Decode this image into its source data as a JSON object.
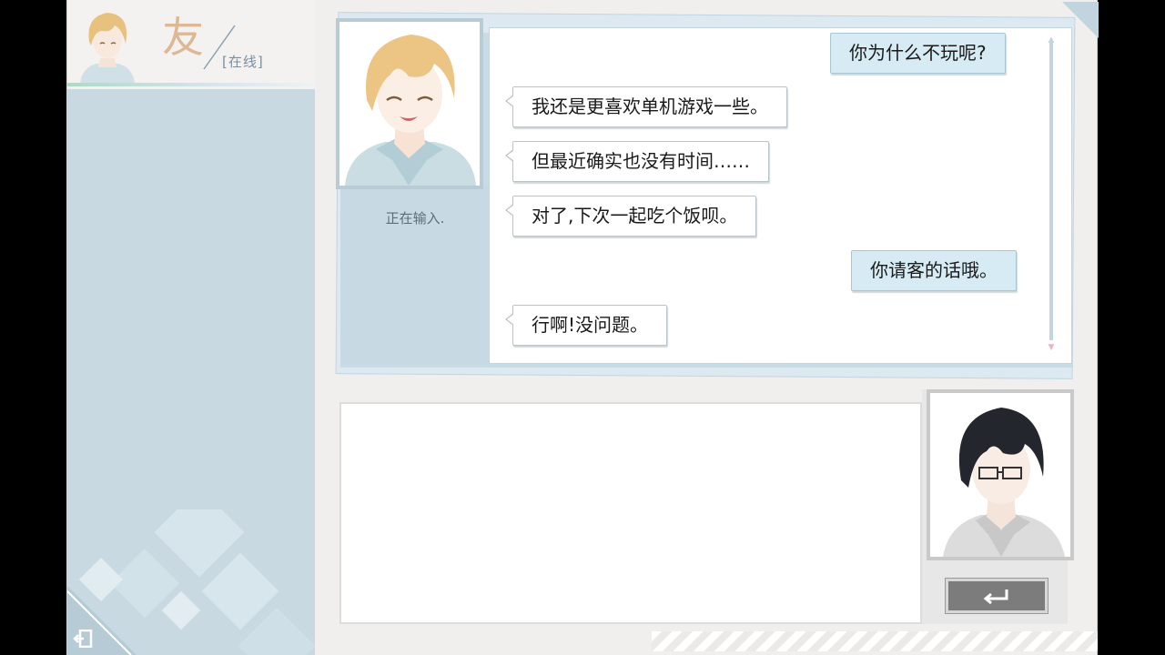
{
  "contact": {
    "name": "友",
    "status": "[在线]",
    "typing_status": "正在输入."
  },
  "messages": [
    {
      "sender": "self",
      "text": "你为什么不玩呢?"
    },
    {
      "sender": "friend",
      "text": "我还是更喜欢单机游戏一些。"
    },
    {
      "sender": "friend",
      "text": "但最近确实也没有时间……"
    },
    {
      "sender": "friend",
      "text": "对了,下次一起吃个饭呗。"
    },
    {
      "sender": "self",
      "text": "你请客的话哦。"
    },
    {
      "sender": "friend",
      "text": "行啊!没问题。"
    }
  ],
  "input": {
    "value": ""
  },
  "icons": {
    "exit": "exit-icon",
    "send": "enter-return-icon",
    "scroll_up": "chevron-up-icon",
    "scroll_down": "chevron-down-icon"
  },
  "colors": {
    "panel_blue": "#c8d9e2",
    "self_bubble": "#d6ebf3",
    "name_accent": "#dcb894"
  }
}
